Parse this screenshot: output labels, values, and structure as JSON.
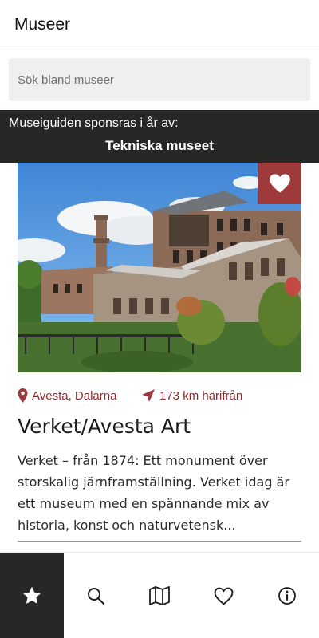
{
  "header": {
    "title": "Museer"
  },
  "search": {
    "placeholder": "Sök bland museer"
  },
  "sponsor": {
    "intro": "Museiguiden sponsras i år av:",
    "name": "Tekniska museet"
  },
  "museum": {
    "location": "Avesta, Dalarna",
    "distance": "173 km härifrån",
    "name": "Verket/Avesta Art",
    "description": "Verket – från 1874: Ett monument över storskalig järnframställning. Verket idag är ett museum med en spännande mix av historia, konst och naturvetensk...",
    "favorite_icon": "heart-icon"
  },
  "tabs": [
    {
      "id": "featured",
      "icon": "star-icon",
      "active": true
    },
    {
      "id": "search",
      "icon": "search-icon",
      "active": false
    },
    {
      "id": "map",
      "icon": "map-icon",
      "active": false
    },
    {
      "id": "favorites",
      "icon": "heart-outline-icon",
      "active": false
    },
    {
      "id": "info",
      "icon": "info-icon",
      "active": false
    }
  ],
  "colors": {
    "accent": "#9e3a3c",
    "dark": "#262825",
    "location_text": "#8e2b2d"
  }
}
